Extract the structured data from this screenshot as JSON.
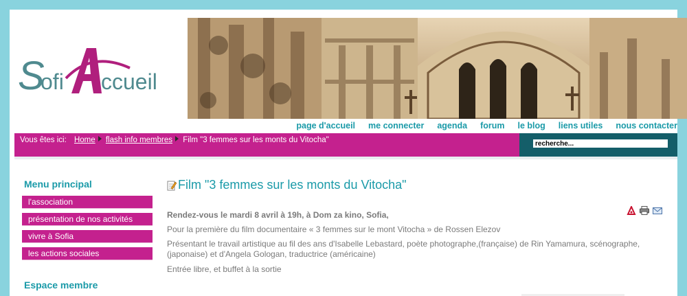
{
  "logo": {
    "text": "SofiAccueil"
  },
  "nav": [
    "page d'accueil",
    "me connecter",
    "agenda",
    "forum",
    "le blog",
    "liens utiles",
    "nous contacter"
  ],
  "breadcrumb": {
    "prefix": "Vous êtes ici:",
    "items": [
      "Home",
      "flash info membres"
    ],
    "current": "Film \"3 femmes sur les monts du Vitocha\""
  },
  "search": {
    "value": "recherche..."
  },
  "sidebar": {
    "title": "Menu principal",
    "items": [
      "l'association",
      "présentation de nos activités",
      "vivre à Sofia",
      "les actions sociales"
    ],
    "member_title": "Espace membre"
  },
  "article": {
    "title": "Film \"3 femmes sur les monts du Vitocha\"",
    "tools": [
      "pdf-icon",
      "print-icon",
      "email-icon"
    ],
    "paragraphs": [
      "Rendez-vous le mardi 8 avril à 19h, à Dom za kino, Sofia,",
      "Pour la première du film documentaire «  3 femmes sur le mont Vitocha » de Rossen Elezov",
      "Présentant le travail artistique au fil des ans d'Isabelle Lebastard, poète photographe,(française) de Rin Yamamura, scénographe, (japonaise) et d'Angela Gologan, traductrice (américaine)",
      "Entrée libre, et buffet à la sortie"
    ]
  },
  "colors": {
    "magenta": "#c4218e",
    "teal": "#1a9aa8",
    "dark_teal": "#145e69",
    "frame": "#89d3de"
  }
}
